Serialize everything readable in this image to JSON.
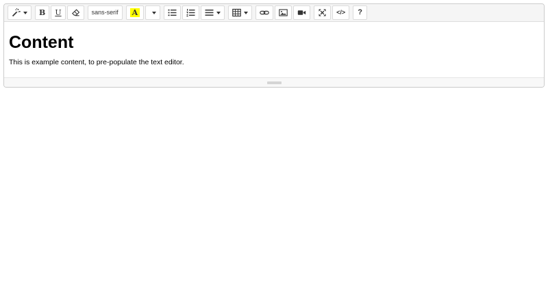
{
  "editor": {
    "toolbar": {
      "groups": [
        {
          "name": "style",
          "buttons": [
            {
              "name": "style-dropdown",
              "icon": "magic-wand-icon",
              "caret": true
            }
          ]
        },
        {
          "name": "font",
          "buttons": [
            {
              "name": "bold",
              "text": "B",
              "text_class": "glyph-bold",
              "glyph_name": "bold-icon"
            },
            {
              "name": "underline",
              "text": "U",
              "text_class": "glyph-underline",
              "glyph_name": "underline-icon"
            },
            {
              "name": "clear-formatting",
              "icon": "eraser-icon"
            }
          ]
        },
        {
          "name": "fontname",
          "buttons": [
            {
              "name": "fontname-dropdown",
              "text": "sans-serif",
              "text_class": "glyph-fontname",
              "glyph_name": "fontname-label"
            }
          ]
        },
        {
          "name": "color",
          "buttons": [
            {
              "name": "recent-color",
              "text": "A",
              "text_class": "glyph-color",
              "glyph_name": "font-color-icon",
              "swatch": "#ffff00"
            },
            {
              "name": "color-dropdown",
              "caret": true
            }
          ]
        },
        {
          "name": "para",
          "buttons": [
            {
              "name": "unordered-list",
              "icon": "unordered-list-icon"
            },
            {
              "name": "ordered-list",
              "icon": "ordered-list-icon"
            },
            {
              "name": "paragraph-dropdown",
              "icon": "align-left-icon",
              "caret": true
            }
          ]
        },
        {
          "name": "table",
          "buttons": [
            {
              "name": "table-dropdown",
              "icon": "table-icon",
              "caret": true
            }
          ]
        },
        {
          "name": "insert",
          "buttons": [
            {
              "name": "insert-link",
              "icon": "link-icon"
            },
            {
              "name": "insert-picture",
              "icon": "picture-icon"
            },
            {
              "name": "insert-video",
              "icon": "video-icon"
            }
          ]
        },
        {
          "name": "view",
          "buttons": [
            {
              "name": "fullscreen",
              "icon": "fullscreen-icon"
            },
            {
              "name": "codeview",
              "text": "</>",
              "text_class": "glyph-code",
              "glyph_name": "code-view-icon"
            }
          ]
        },
        {
          "name": "help",
          "buttons": [
            {
              "name": "help",
              "text": "?",
              "text_class": "glyph-help",
              "glyph_name": "help-icon"
            }
          ]
        }
      ]
    },
    "content": {
      "heading": "Content",
      "paragraph": "This is example content, to pre-populate the text editor."
    },
    "colors": {
      "recent_color_swatch": "#ffff00",
      "toolbar_background": "#f5f5f5",
      "icon_color": "#333333"
    }
  }
}
